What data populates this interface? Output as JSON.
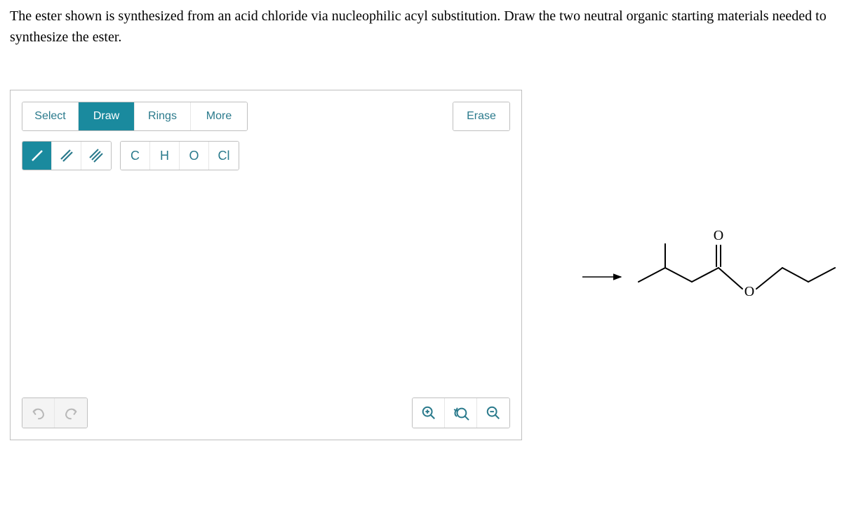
{
  "question": "The ester shown is synthesized from an acid chloride via nucleophilic acyl substitution. Draw the two neutral organic starting materials needed to synthesize the ester.",
  "toolbar": {
    "select": "Select",
    "draw": "Draw",
    "rings": "Rings",
    "more": "More",
    "erase": "Erase"
  },
  "elements": {
    "c": "C",
    "h": "H",
    "o": "O",
    "cl": "Cl"
  },
  "molecule": {
    "atom_o1": "O",
    "atom_o2": "O"
  }
}
